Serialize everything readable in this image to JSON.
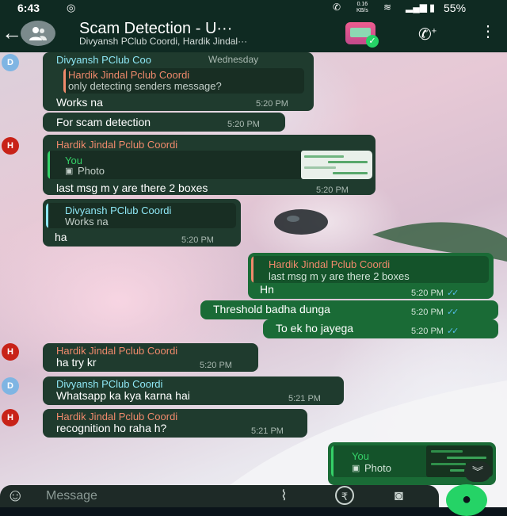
{
  "status_bar": {
    "time": "6:43",
    "speed_value": "0.16",
    "speed_unit": "KB/s",
    "battery": "55%"
  },
  "header": {
    "title": "Scam Detection - U···",
    "subtitle": "Divyansh PClub Coordi, Hardik Jindal···"
  },
  "messages": [
    {
      "sender": "Divyansh PClub Coo",
      "day": "Wednesday",
      "quote_sender": "Hardik Jindal Pclub Coordi",
      "quote_text": "only detecting senders message?",
      "text": "Works na",
      "time": "5:20 PM"
    },
    {
      "text": "For scam detection",
      "time": "5:20 PM"
    },
    {
      "sender": "Hardik Jindal Pclub Coordi",
      "quote_sender": "You",
      "quote_text": "Photo",
      "text": "last msg m y are there 2 boxes",
      "time": "5:20 PM"
    },
    {
      "quote_sender": "Divyansh PClub Coordi",
      "quote_text": "Works na",
      "text": "ha",
      "time": "5:20 PM"
    },
    {
      "quote_sender": "Hardik Jindal Pclub Coordi",
      "quote_text": "last msg m y are there 2 boxes",
      "text": "Hn",
      "time": "5:20 PM"
    },
    {
      "text": "Threshold badha dunga",
      "time": "5:20 PM"
    },
    {
      "text": "To ek ho jayega",
      "time": "5:20 PM"
    },
    {
      "sender": "Hardik Jindal Pclub Coordi",
      "text": "ha try kr",
      "time": "5:20 PM"
    },
    {
      "sender": "Divyansh PClub Coordi",
      "text": "Whatsapp ka kya karna hai",
      "time": "5:21 PM"
    },
    {
      "sender": "Hardik Jindal Pclub Coordi",
      "text": "recognition ho raha h?",
      "time": "5:21 PM"
    },
    {
      "quote_sender": "You",
      "quote_text": "Photo"
    }
  ],
  "avatars": {
    "d": "D",
    "h": "H"
  },
  "composer": {
    "placeholder": "Message"
  },
  "colors": {
    "bar_bg": "#0f2a22",
    "incoming_bubble": "#1f3b2e",
    "outgoing_bubble": "#1a6b36",
    "sender_divyansh": "#8ee7f5",
    "sender_hardik": "#f08a6c",
    "you_label": "#35d168",
    "read_ticks": "#53bdeb",
    "mic_button": "#25d366"
  },
  "icons": [
    "back-arrow-icon",
    "group-icon",
    "video-call-icon",
    "add-call-icon",
    "more-vert-icon",
    "photo-icon",
    "read-ticks-icon",
    "chevron-down-icon",
    "emoji-icon",
    "attach-icon",
    "rupee-icon",
    "camera-icon",
    "mic-icon"
  ]
}
